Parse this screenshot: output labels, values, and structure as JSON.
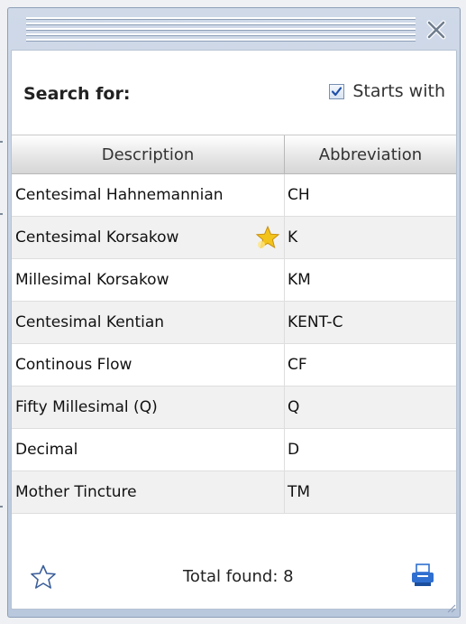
{
  "search": {
    "label": "Search for:",
    "starts_with_label": "Starts with",
    "starts_with_checked": true
  },
  "table": {
    "headers": [
      "Description",
      "Abbreviation"
    ],
    "rows": [
      {
        "description": "Centesimal Hahnemannian",
        "abbreviation": "CH",
        "starred": false
      },
      {
        "description": "Centesimal Korsakow",
        "abbreviation": "K",
        "starred": true
      },
      {
        "description": "Millesimal Korsakow",
        "abbreviation": "KM",
        "starred": false
      },
      {
        "description": "Centesimal Kentian",
        "abbreviation": "KENT-C",
        "starred": false
      },
      {
        "description": "Continous Flow",
        "abbreviation": "CF",
        "starred": false
      },
      {
        "description": "Fifty Millesimal (Q)",
        "abbreviation": "Q",
        "starred": false
      },
      {
        "description": "Decimal",
        "abbreviation": "D",
        "starred": false
      },
      {
        "description": "Mother Tincture",
        "abbreviation": "TM",
        "starred": false
      }
    ]
  },
  "footer": {
    "total_text": "Total found: 8"
  },
  "icons": {
    "close": "close-icon",
    "favorites": "star-outline-icon",
    "row_star": "star-gold-icon",
    "print": "printer-icon",
    "check": "checkmark-icon"
  },
  "colors": {
    "accent": "#2f6fd0",
    "star_gold": "#f2c31b",
    "title_bar": "#c4d2e6"
  }
}
